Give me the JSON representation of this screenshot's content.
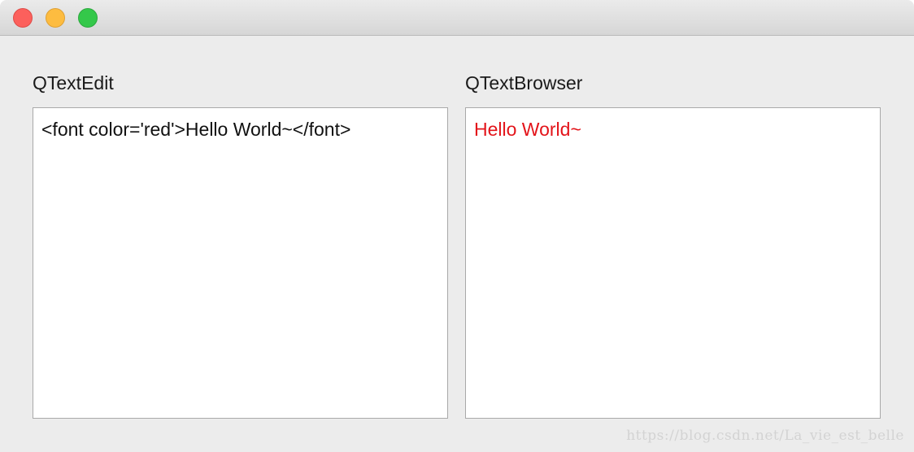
{
  "window": {
    "controls": {
      "close": {
        "icon": "close-icon",
        "color": "#fc605c"
      },
      "minimize": {
        "icon": "minimize-icon",
        "color": "#fdbc40"
      },
      "zoom": {
        "icon": "zoom-icon",
        "color": "#34c84a"
      }
    }
  },
  "left_panel": {
    "label": "QTextEdit",
    "content": "<font color='red'>Hello World~</font>"
  },
  "right_panel": {
    "label": "QTextBrowser",
    "content": "Hello World~",
    "content_color": "#e3141a"
  },
  "watermark": "https://blog.csdn.net/La_vie_est_belle"
}
